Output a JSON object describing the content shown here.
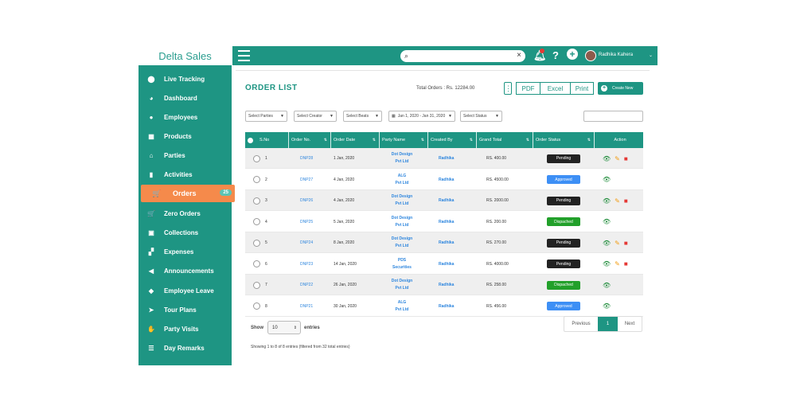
{
  "brand": "Delta Sales",
  "sidebar": {
    "items": [
      {
        "label": "Live Tracking",
        "icon": "location-pin-icon",
        "glyph": "⬤"
      },
      {
        "label": "Dashboard",
        "icon": "speedometer-icon",
        "glyph": "◕"
      },
      {
        "label": "Employees",
        "icon": "person-icon",
        "glyph": "●"
      },
      {
        "label": "Products",
        "icon": "grid-icon",
        "glyph": "▦"
      },
      {
        "label": "Parties",
        "icon": "house-icon",
        "glyph": "⌂"
      },
      {
        "label": "Activities",
        "icon": "file-icon",
        "glyph": "▮"
      },
      {
        "label": "Orders",
        "icon": "cart-icon",
        "glyph": "🛒",
        "badge": "25",
        "active": true
      },
      {
        "label": "Zero Orders",
        "icon": "cart-icon",
        "glyph": "🛒"
      },
      {
        "label": "Collections",
        "icon": "money-icon",
        "glyph": "▣"
      },
      {
        "label": "Expenses",
        "icon": "tiles-icon",
        "glyph": "▞"
      },
      {
        "label": "Announcements",
        "icon": "speaker-icon",
        "glyph": "◀"
      },
      {
        "label": "Employee Leave",
        "icon": "tag-icon",
        "glyph": "◆"
      },
      {
        "label": "Tour Plans",
        "icon": "paper-plane-icon",
        "glyph": "➤"
      },
      {
        "label": "Party Visits",
        "icon": "handshake-icon",
        "glyph": "✋"
      },
      {
        "label": "Day Remarks",
        "icon": "notes-icon",
        "glyph": "☰"
      }
    ]
  },
  "topbar": {
    "notification_count": "•",
    "user_name": "Radhika Kahera"
  },
  "main": {
    "title": "ORDER LIST",
    "total_orders": "Total Orders : Rs. 12284.00",
    "exports": [
      "PDF",
      "Excel",
      "Print"
    ],
    "create_label": "Create New",
    "filters": [
      {
        "label": "Select Parties"
      },
      {
        "label": "Select Creator"
      },
      {
        "label": "Select Beats"
      },
      {
        "label": "Jan 1, 2020 - Jan 31, 2020"
      },
      {
        "label": "Select Status"
      }
    ],
    "columns": [
      "S.No",
      "Order No.",
      "Order Date",
      "Party Name",
      "Created By",
      "Grand Total",
      "Order Status",
      "Action"
    ],
    "rows": [
      {
        "sno": "1",
        "order_no": "DNP28",
        "date": "1 Jan, 2020",
        "party1": "Dot Design",
        "party2": "Pvt Ltd",
        "created_by": "Radhika",
        "total": "RS. 400.00",
        "status": "Pending",
        "status_color": "#222222",
        "edit": true
      },
      {
        "sno": "2",
        "order_no": "DNP27",
        "date": "4 Jan, 2020",
        "party1": "ALG",
        "party2": "Pvt Ltd",
        "created_by": "Radhika",
        "total": "RS. 4500.00",
        "status": "Approved",
        "status_color": "#3d8ff5",
        "edit": false
      },
      {
        "sno": "3",
        "order_no": "DNP26",
        "date": "4 Jan, 2020",
        "party1": "Dot Design",
        "party2": "Pvt Ltd",
        "created_by": "Radhika",
        "total": "RS. 2000.00",
        "status": "Pending",
        "status_color": "#222222",
        "edit": true
      },
      {
        "sno": "4",
        "order_no": "DNP25",
        "date": "5 Jan, 2020",
        "party1": "Dot Design",
        "party2": "Pvt Ltd",
        "created_by": "Radhika",
        "total": "RS. 200.00",
        "status": "Dispached",
        "status_color": "#22a02a",
        "edit": false
      },
      {
        "sno": "5",
        "order_no": "DNP24",
        "date": "8 Jan, 2020",
        "party1": "Dot Design",
        "party2": "Pvt Ltd",
        "created_by": "Radhika",
        "total": "RS. 270.00",
        "status": "Pending",
        "status_color": "#222222",
        "edit": true
      },
      {
        "sno": "6",
        "order_no": "DNP23",
        "date": "14 Jan, 2020",
        "party1": "PDS",
        "party2": "Securities",
        "created_by": "Radhika",
        "total": "RS. 4000.00",
        "status": "Pending",
        "status_color": "#222222",
        "edit": true
      },
      {
        "sno": "7",
        "order_no": "DNP22",
        "date": "26 Jan, 2020",
        "party1": "Dot Design",
        "party2": "Pvt Ltd",
        "created_by": "Radhika",
        "total": "RS. 258.00",
        "status": "Dispached",
        "status_color": "#22a02a",
        "edit": false
      },
      {
        "sno": "8",
        "order_no": "DNP21",
        "date": "30 Jan, 2020",
        "party1": "ALG",
        "party2": "Pvt Ltd",
        "created_by": "Radhika",
        "total": "RS. 456.00",
        "status": "Approved",
        "status_color": "#3d8ff5",
        "edit": false
      }
    ],
    "show_label": "Show",
    "page_size": "10",
    "entries_label": "entries",
    "showing": "Showing 1 to 8 of 8 entries (filtered from 32 total entries)",
    "pager": {
      "prev": "Previous",
      "current": "1",
      "next": "Next"
    }
  },
  "colors": {
    "accent": "#1e9583",
    "active": "#f58a4b"
  }
}
